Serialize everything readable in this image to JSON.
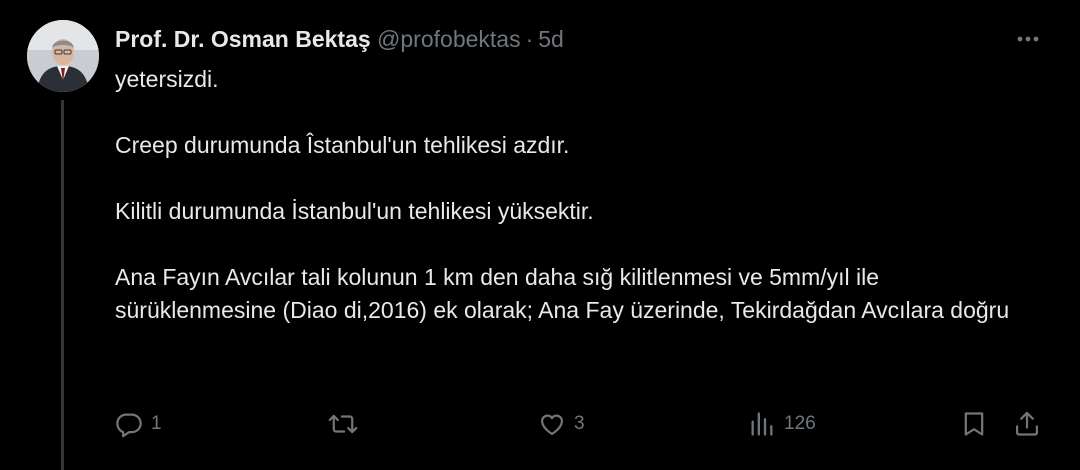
{
  "author": {
    "name": "Prof. Dr. Osman Bektaş",
    "handle": "@profobektas",
    "separator": "·",
    "time": "5d"
  },
  "tweet": {
    "paragraphs": [
      "yetersizdi.",
      "Creep durumunda Îstanbul'un tehlikesi azdır.",
      "Kilitli durumunda İstanbul'un tehlikesi yüksektir.",
      "Ana Fayın Avcılar tali kolunun 1 km den daha sığ kilitlenmesi ve 5mm/yıl ile sürüklenmesine (Diao di,2016) ek olarak; Ana Fay üzerinde, Tekirdağdan Avcılara doğru"
    ]
  },
  "actions": {
    "reply_count": "1",
    "repost_count": "",
    "like_count": "3",
    "views_count": "126"
  },
  "icons": [
    "more-icon",
    "reply-icon",
    "repost-icon",
    "like-icon",
    "views-icon",
    "bookmark-icon",
    "share-icon"
  ],
  "colors": {
    "background": "#000000",
    "text": "#e7e9ea",
    "secondary": "#71767b",
    "thread_line": "#333639"
  }
}
